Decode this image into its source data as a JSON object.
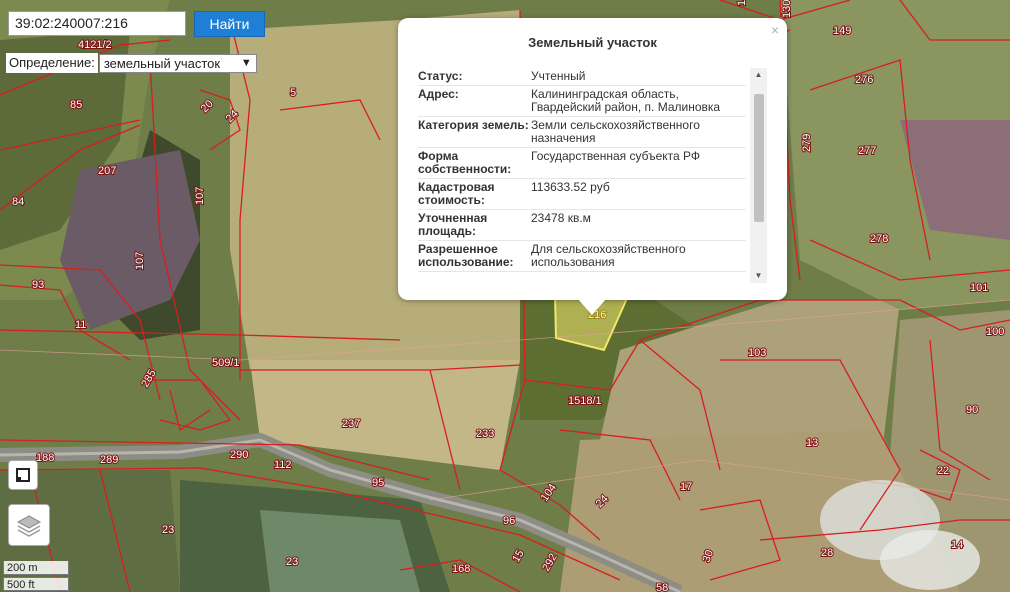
{
  "search": {
    "value": "39:02:240007:216",
    "button_label": "Найти"
  },
  "definition": {
    "label": "Определение:",
    "selected": "земельный участок"
  },
  "popup": {
    "title": "Земельный участок",
    "close_glyph": "×",
    "rows": [
      {
        "key": "Статус:",
        "value": "Учтенный"
      },
      {
        "key": "Адрес:",
        "value": "Калининградская область, Гвардейский район, п. Малиновка"
      },
      {
        "key": "Категория земель:",
        "value": "Земли сельскохозяйственного назначения"
      },
      {
        "key": "Форма собственности:",
        "value": "Государственная субъекта РФ"
      },
      {
        "key": "Кадастровая стоимость:",
        "value": "113633.52 руб"
      },
      {
        "key": "Уточненная площадь:",
        "value": "23478 кв.м"
      },
      {
        "key": "Разрешенное использование:",
        "value": "Для сельскохозяйственного использования"
      }
    ]
  },
  "scale": {
    "metric": "200 m",
    "imperial": "500 ft"
  },
  "parcel_labels": [
    "4121/2",
    "85",
    "5",
    "20",
    "24",
    "147",
    "130",
    "149",
    "207",
    "107",
    "84",
    "107",
    "276",
    "279",
    "277",
    "278",
    "93",
    "11",
    "509/1",
    "285",
    "101",
    "100",
    "103",
    "90",
    "1518/1",
    "237",
    "233",
    "13",
    "188",
    "289",
    "290",
    "112",
    "95",
    "22",
    "104",
    "17",
    "24",
    "96",
    "23",
    "23",
    "30",
    "28",
    "14",
    "168",
    "15",
    "292",
    "58",
    "216"
  ],
  "colors": {
    "parcel_border": "#d81e1e",
    "highlight": "#f2e86a",
    "button": "#1f7fd6"
  },
  "icons": {
    "fullscreen": "fullscreen-icon",
    "layers": "layers-icon",
    "close": "close-icon"
  }
}
